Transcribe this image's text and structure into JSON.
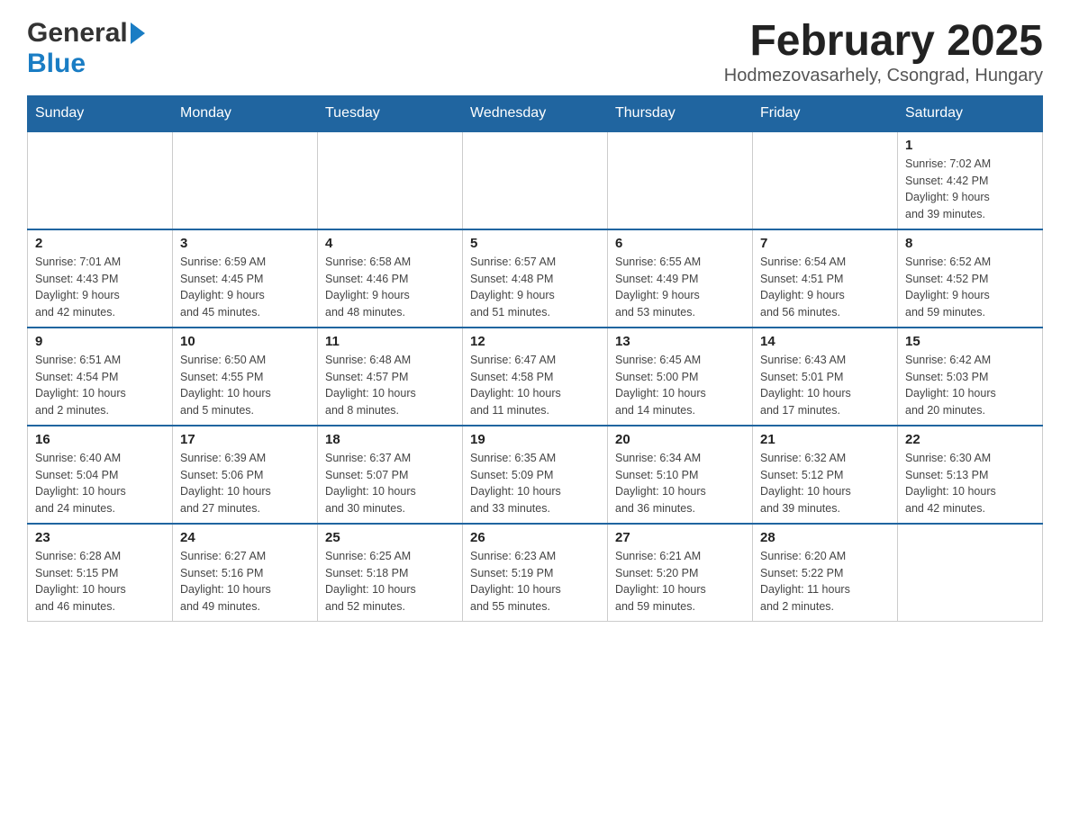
{
  "header": {
    "logo_general": "General",
    "logo_blue": "Blue",
    "month_title": "February 2025",
    "location": "Hodmezovasarhely, Csongrad, Hungary"
  },
  "weekdays": [
    "Sunday",
    "Monday",
    "Tuesday",
    "Wednesday",
    "Thursday",
    "Friday",
    "Saturday"
  ],
  "weeks": [
    [
      {
        "day": "",
        "info": ""
      },
      {
        "day": "",
        "info": ""
      },
      {
        "day": "",
        "info": ""
      },
      {
        "day": "",
        "info": ""
      },
      {
        "day": "",
        "info": ""
      },
      {
        "day": "",
        "info": ""
      },
      {
        "day": "1",
        "info": "Sunrise: 7:02 AM\nSunset: 4:42 PM\nDaylight: 9 hours\nand 39 minutes."
      }
    ],
    [
      {
        "day": "2",
        "info": "Sunrise: 7:01 AM\nSunset: 4:43 PM\nDaylight: 9 hours\nand 42 minutes."
      },
      {
        "day": "3",
        "info": "Sunrise: 6:59 AM\nSunset: 4:45 PM\nDaylight: 9 hours\nand 45 minutes."
      },
      {
        "day": "4",
        "info": "Sunrise: 6:58 AM\nSunset: 4:46 PM\nDaylight: 9 hours\nand 48 minutes."
      },
      {
        "day": "5",
        "info": "Sunrise: 6:57 AM\nSunset: 4:48 PM\nDaylight: 9 hours\nand 51 minutes."
      },
      {
        "day": "6",
        "info": "Sunrise: 6:55 AM\nSunset: 4:49 PM\nDaylight: 9 hours\nand 53 minutes."
      },
      {
        "day": "7",
        "info": "Sunrise: 6:54 AM\nSunset: 4:51 PM\nDaylight: 9 hours\nand 56 minutes."
      },
      {
        "day": "8",
        "info": "Sunrise: 6:52 AM\nSunset: 4:52 PM\nDaylight: 9 hours\nand 59 minutes."
      }
    ],
    [
      {
        "day": "9",
        "info": "Sunrise: 6:51 AM\nSunset: 4:54 PM\nDaylight: 10 hours\nand 2 minutes."
      },
      {
        "day": "10",
        "info": "Sunrise: 6:50 AM\nSunset: 4:55 PM\nDaylight: 10 hours\nand 5 minutes."
      },
      {
        "day": "11",
        "info": "Sunrise: 6:48 AM\nSunset: 4:57 PM\nDaylight: 10 hours\nand 8 minutes."
      },
      {
        "day": "12",
        "info": "Sunrise: 6:47 AM\nSunset: 4:58 PM\nDaylight: 10 hours\nand 11 minutes."
      },
      {
        "day": "13",
        "info": "Sunrise: 6:45 AM\nSunset: 5:00 PM\nDaylight: 10 hours\nand 14 minutes."
      },
      {
        "day": "14",
        "info": "Sunrise: 6:43 AM\nSunset: 5:01 PM\nDaylight: 10 hours\nand 17 minutes."
      },
      {
        "day": "15",
        "info": "Sunrise: 6:42 AM\nSunset: 5:03 PM\nDaylight: 10 hours\nand 20 minutes."
      }
    ],
    [
      {
        "day": "16",
        "info": "Sunrise: 6:40 AM\nSunset: 5:04 PM\nDaylight: 10 hours\nand 24 minutes."
      },
      {
        "day": "17",
        "info": "Sunrise: 6:39 AM\nSunset: 5:06 PM\nDaylight: 10 hours\nand 27 minutes."
      },
      {
        "day": "18",
        "info": "Sunrise: 6:37 AM\nSunset: 5:07 PM\nDaylight: 10 hours\nand 30 minutes."
      },
      {
        "day": "19",
        "info": "Sunrise: 6:35 AM\nSunset: 5:09 PM\nDaylight: 10 hours\nand 33 minutes."
      },
      {
        "day": "20",
        "info": "Sunrise: 6:34 AM\nSunset: 5:10 PM\nDaylight: 10 hours\nand 36 minutes."
      },
      {
        "day": "21",
        "info": "Sunrise: 6:32 AM\nSunset: 5:12 PM\nDaylight: 10 hours\nand 39 minutes."
      },
      {
        "day": "22",
        "info": "Sunrise: 6:30 AM\nSunset: 5:13 PM\nDaylight: 10 hours\nand 42 minutes."
      }
    ],
    [
      {
        "day": "23",
        "info": "Sunrise: 6:28 AM\nSunset: 5:15 PM\nDaylight: 10 hours\nand 46 minutes."
      },
      {
        "day": "24",
        "info": "Sunrise: 6:27 AM\nSunset: 5:16 PM\nDaylight: 10 hours\nand 49 minutes."
      },
      {
        "day": "25",
        "info": "Sunrise: 6:25 AM\nSunset: 5:18 PM\nDaylight: 10 hours\nand 52 minutes."
      },
      {
        "day": "26",
        "info": "Sunrise: 6:23 AM\nSunset: 5:19 PM\nDaylight: 10 hours\nand 55 minutes."
      },
      {
        "day": "27",
        "info": "Sunrise: 6:21 AM\nSunset: 5:20 PM\nDaylight: 10 hours\nand 59 minutes."
      },
      {
        "day": "28",
        "info": "Sunrise: 6:20 AM\nSunset: 5:22 PM\nDaylight: 11 hours\nand 2 minutes."
      },
      {
        "day": "",
        "info": ""
      }
    ]
  ]
}
